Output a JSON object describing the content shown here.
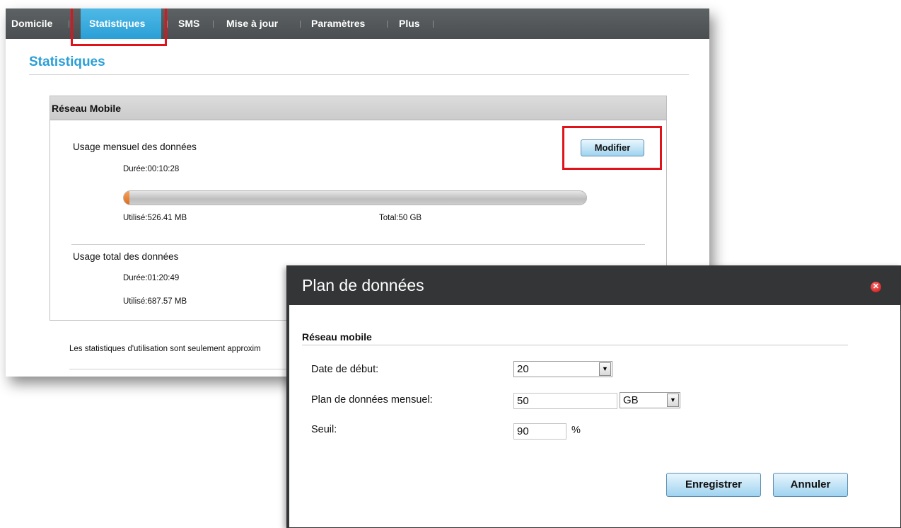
{
  "nav": {
    "items": [
      {
        "label": "Domicile"
      },
      {
        "label": "Statistiques"
      },
      {
        "label": "SMS"
      },
      {
        "label": "Mise à jour"
      },
      {
        "label": "Paramètres"
      },
      {
        "label": "Plus"
      }
    ],
    "active": "Statistiques"
  },
  "page": {
    "title": "Statistiques",
    "panel_title": "Réseau Mobile",
    "monthly": {
      "label": "Usage mensuel des données",
      "duration": "Durée:00:10:28",
      "used": "Utilisé:526.41 MB",
      "total": "Total:50 GB",
      "usage_fraction": 0.0103
    },
    "modify_button": "Modifier",
    "overall": {
      "label": "Usage total des données",
      "duration": "Durée:01:20:49",
      "used": "Utilisé:687.57 MB"
    },
    "footnote": "Les statistiques d'utilisation sont seulement approxim"
  },
  "dialog": {
    "title": "Plan de données",
    "section": "Réseau mobile",
    "start_date": {
      "label": "Date de début:",
      "value": "20"
    },
    "plan": {
      "label": "Plan de données mensuel:",
      "value": "50",
      "unit": "GB"
    },
    "threshold": {
      "label": "Seuil:",
      "value": "90",
      "unit": "%"
    },
    "save_button": "Enregistrer",
    "cancel_button": "Annuler"
  },
  "colors": {
    "accent": "#2a9fd6",
    "highlight": "#e0121a",
    "nav_bg": "#4a4e50",
    "progress": "#e06a1a"
  }
}
